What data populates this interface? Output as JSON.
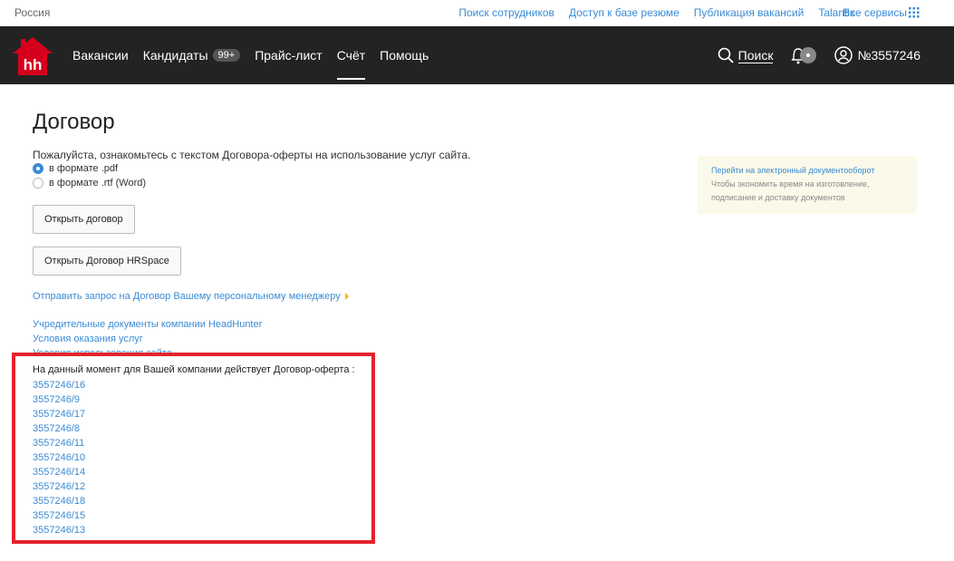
{
  "topbar": {
    "region": "Россия",
    "links": [
      "Поиск сотрудников",
      "Доступ к базе резюме",
      "Публикация вакансий",
      "Talantix"
    ],
    "all_services": "Все сервисы"
  },
  "navbar": {
    "logo_text": "hh",
    "items": [
      {
        "label": "Вакансии"
      },
      {
        "label": "Кандидаты",
        "badge": "99+"
      },
      {
        "label": "Прайс-лист"
      },
      {
        "label": "Счёт",
        "active": true
      },
      {
        "label": "Помощь"
      }
    ],
    "search_label": "Поиск",
    "account_number": "№3557246"
  },
  "main": {
    "title": "Договор",
    "intro": "Пожалуйста, ознакомьтесь с текстом Договора-оферты на использование услуг сайта.",
    "formats": [
      {
        "label": "в формате .pdf",
        "checked": true
      },
      {
        "label": "в формате .rtf (Word)",
        "checked": false
      }
    ],
    "open_contract_button": "Открыть договор",
    "open_hrspace_button": "Открыть Договор HRSpace",
    "request_link": "Отправить запрос на Договор Вашему персональному менеджеру",
    "doc_links": [
      "Учредительные документы компании HeadHunter",
      "Условия оказания услуг",
      "Условия использования сайта"
    ],
    "offer_text": "На данный момент для Вашей компании действует Договор-оферта :",
    "contracts": [
      "3557246/16",
      "3557246/9",
      "3557246/17",
      "3557246/8",
      "3557246/11",
      "3557246/10",
      "3557246/14",
      "3557246/12",
      "3557246/18",
      "3557246/15",
      "3557246/13"
    ]
  },
  "notice": {
    "link": "Перейти на электронный документооборот",
    "text": "Чтобы экономить время на изготовление, подписание и доставку документов"
  },
  "colors": {
    "accent": "#3a8bd5",
    "navbar": "#232323",
    "highlight": "#e3232c",
    "logo": "#d6001c"
  }
}
